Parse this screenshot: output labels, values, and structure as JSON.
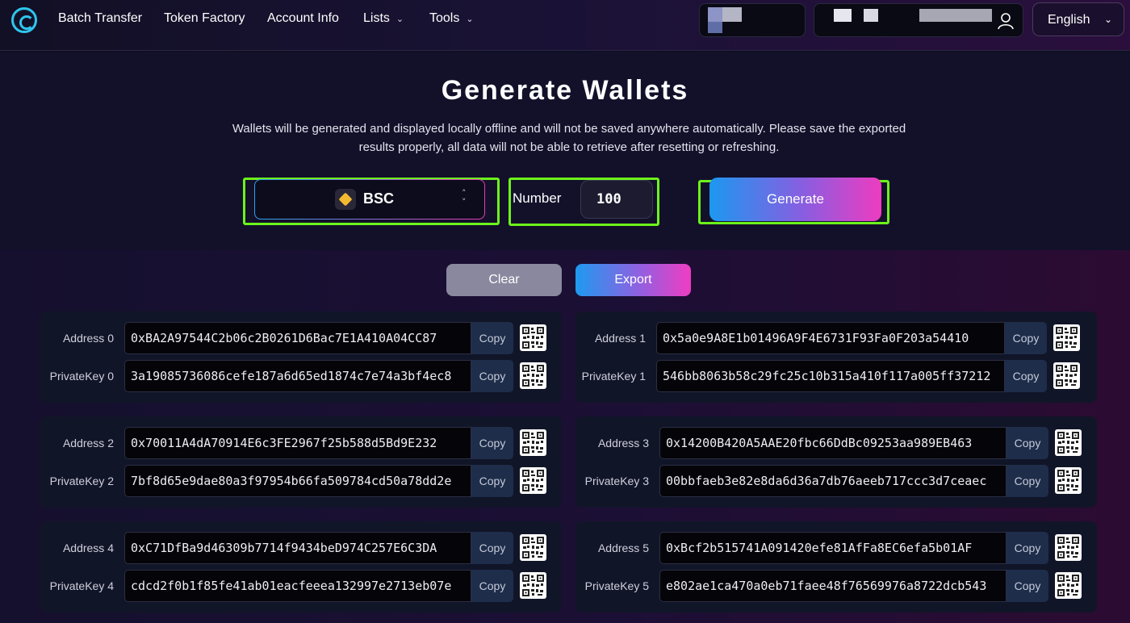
{
  "nav": {
    "items": [
      {
        "label": "Batch Transfer",
        "dropdown": false
      },
      {
        "label": "Token Factory",
        "dropdown": false
      },
      {
        "label": "Account Info",
        "dropdown": false
      },
      {
        "label": "Lists",
        "dropdown": true
      },
      {
        "label": "Tools",
        "dropdown": true
      }
    ],
    "language": "English"
  },
  "hero": {
    "title": "Generate Wallets",
    "description": "Wallets will be generated and displayed locally offline and will not be saved anywhere automatically. Please save the exported results properly, all data will not be able to retrieve after resetting or refreshing.",
    "chain": "BSC",
    "number_label": "Number",
    "number_value": "100",
    "generate_label": "Generate"
  },
  "actions": {
    "clear_label": "Clear",
    "export_label": "Export"
  },
  "wallets": [
    {
      "address_label": "Address 0",
      "key_label": "PrivateKey 0",
      "address": "0xBA2A97544C2b06c2B0261D6Bac7E1A410A04CC87",
      "private_key": "3a19085736086cefe187a6d65ed1874c7e74a3bf4ec8"
    },
    {
      "address_label": "Address 1",
      "key_label": "PrivateKey 1",
      "address": "0x5a0e9A8E1b01496A9F4E6731F93Fa0F203a54410",
      "private_key": "546bb8063b58c29fc25c10b315a410f117a005ff37212"
    },
    {
      "address_label": "Address 2",
      "key_label": "PrivateKey 2",
      "address": "0x70011A4dA70914E6c3FE2967f25b588d5Bd9E232",
      "private_key": "7bf8d65e9dae80a3f97954b66fa509784cd50a78dd2e"
    },
    {
      "address_label": "Address 3",
      "key_label": "PrivateKey 3",
      "address": "0x14200B420A5AAE20fbc66DdBc09253aa989EB463",
      "private_key": "00bbfaeb3e82e8da6d36a7db76aeeb717ccc3d7ceaec"
    },
    {
      "address_label": "Address 4",
      "key_label": "PrivateKey 4",
      "address": "0xC71DfBa9d46309b7714f9434beD974C257E6C3DA",
      "private_key": "cdcd2f0b1f85fe41ab01eacfeeea132997e2713eb07e"
    },
    {
      "address_label": "Address 5",
      "key_label": "PrivateKey 5",
      "address": "0xBcf2b515741A091420efe81AfFa8EC6efa5b01AF",
      "private_key": "e802ae1ca470a0eb71faee48f76569976a8722dcb543"
    }
  ],
  "copy_label": "Copy",
  "icons": {
    "logo": "app-logo-icon",
    "chevron": "chevron-down-icon",
    "user": "user-icon",
    "chain": "bnb-icon",
    "sort": "up-down-chevron-icon",
    "qr": "qr-code-icon"
  }
}
